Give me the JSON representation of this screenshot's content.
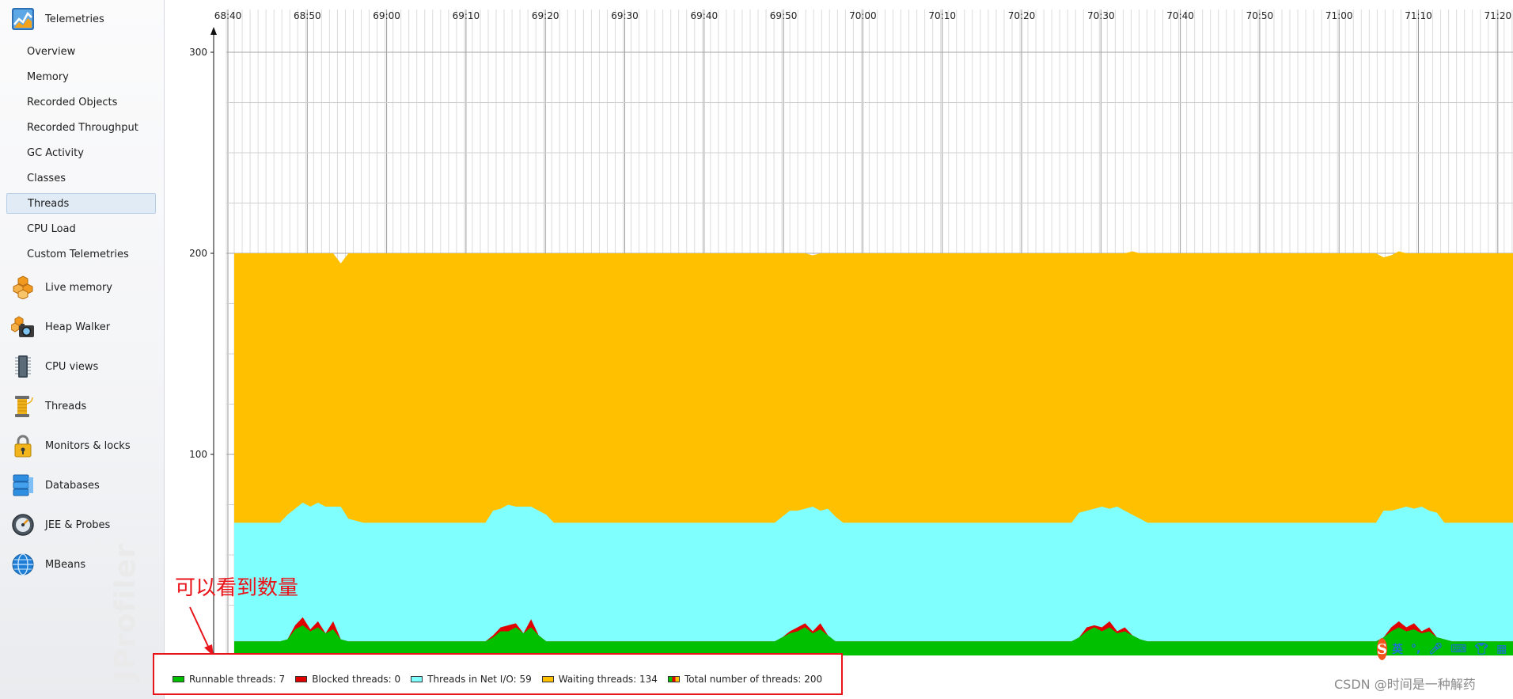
{
  "app": {
    "watermark": "JProfiler"
  },
  "sidebar": {
    "telemetries": {
      "label": "Telemetries",
      "icon": "telemetries-icon",
      "items": [
        {
          "label": "Overview",
          "selected": false
        },
        {
          "label": "Memory",
          "selected": false
        },
        {
          "label": "Recorded Objects",
          "selected": false
        },
        {
          "label": "Recorded Throughput",
          "selected": false
        },
        {
          "label": "GC Activity",
          "selected": false
        },
        {
          "label": "Classes",
          "selected": false
        },
        {
          "label": "Threads",
          "selected": true
        },
        {
          "label": "CPU Load",
          "selected": false
        },
        {
          "label": "Custom Telemetries",
          "selected": false
        }
      ]
    },
    "sections": [
      {
        "label": "Live memory",
        "icon": "live-memory-icon"
      },
      {
        "label": "Heap Walker",
        "icon": "heap-walker-icon"
      },
      {
        "label": "CPU views",
        "icon": "cpu-views-icon"
      },
      {
        "label": "Threads",
        "icon": "threads-icon"
      },
      {
        "label": "Monitors & locks",
        "icon": "monitors-locks-icon"
      },
      {
        "label": "Databases",
        "icon": "databases-icon"
      },
      {
        "label": "JEE & Probes",
        "icon": "jee-probes-icon"
      },
      {
        "label": "MBeans",
        "icon": "mbeans-icon"
      }
    ]
  },
  "chart_data": {
    "type": "area",
    "stacked": true,
    "x_tick_labels": [
      "68:40",
      "68:50",
      "69:00",
      "69:10",
      "69:20",
      "69:30",
      "69:40",
      "69:50",
      "70:00",
      "70:10",
      "70:20",
      "70:30",
      "70:40",
      "70:50",
      "71:00",
      "71:10",
      "71:20"
    ],
    "y_ticks": [
      100,
      200,
      300
    ],
    "ylim": [
      0,
      300
    ],
    "grid": true,
    "series": [
      {
        "name": "Runnable threads",
        "color": "#00c000",
        "values": [
          7,
          7,
          7,
          7,
          7,
          7,
          7,
          8,
          13,
          15,
          12,
          14,
          11,
          13,
          8,
          7,
          7,
          7,
          7,
          7,
          7,
          7,
          7,
          7,
          7,
          7,
          7,
          7,
          7,
          7,
          7,
          7,
          7,
          7,
          9,
          12,
          12,
          14,
          11,
          14,
          10,
          7,
          7,
          7,
          7,
          7,
          7,
          7,
          7,
          7,
          7,
          7,
          7,
          7,
          7,
          7,
          7,
          7,
          7,
          7,
          7,
          7,
          7,
          7,
          7,
          7,
          7,
          7,
          7,
          7,
          7,
          7,
          9,
          11,
          12,
          14,
          11,
          13,
          10,
          7,
          7,
          7,
          7,
          7,
          7,
          7,
          7,
          7,
          7,
          7,
          7,
          7,
          7,
          7,
          7,
          7,
          7,
          7,
          7,
          7,
          7,
          7,
          7,
          7,
          7,
          7,
          7,
          7,
          7,
          7,
          7,
          9,
          12,
          14,
          12,
          14,
          11,
          12,
          10,
          8,
          7,
          7,
          7,
          7,
          7,
          7,
          7,
          7,
          7,
          7,
          7,
          7,
          7,
          7,
          7,
          7,
          7,
          7,
          7,
          7,
          7,
          7,
          7,
          7,
          7,
          7,
          7,
          7,
          7,
          7,
          7,
          9,
          12,
          14,
          12,
          13,
          11,
          12,
          9,
          8,
          7,
          7,
          7,
          7,
          7,
          7,
          7,
          7,
          7
        ]
      },
      {
        "name": "Blocked threads",
        "color": "#e00000",
        "values": [
          0,
          0,
          0,
          0,
          0,
          0,
          0,
          0,
          2,
          4,
          1,
          3,
          0,
          4,
          0,
          0,
          0,
          0,
          0,
          0,
          0,
          0,
          0,
          0,
          0,
          0,
          0,
          0,
          0,
          0,
          0,
          0,
          0,
          0,
          1,
          2,
          3,
          2,
          0,
          4,
          0,
          0,
          0,
          0,
          0,
          0,
          0,
          0,
          0,
          0,
          0,
          0,
          0,
          0,
          0,
          0,
          0,
          0,
          0,
          0,
          0,
          0,
          0,
          0,
          0,
          0,
          0,
          0,
          0,
          0,
          0,
          0,
          0,
          1,
          2,
          2,
          1,
          3,
          0,
          0,
          0,
          0,
          0,
          0,
          0,
          0,
          0,
          0,
          0,
          0,
          0,
          0,
          0,
          0,
          0,
          0,
          0,
          0,
          0,
          0,
          0,
          0,
          0,
          0,
          0,
          0,
          0,
          0,
          0,
          0,
          0,
          0,
          2,
          1,
          2,
          3,
          1,
          2,
          0,
          0,
          0,
          0,
          0,
          0,
          0,
          0,
          0,
          0,
          0,
          0,
          0,
          0,
          0,
          0,
          0,
          0,
          0,
          0,
          0,
          0,
          0,
          0,
          0,
          0,
          0,
          0,
          0,
          0,
          0,
          0,
          0,
          0,
          2,
          3,
          2,
          3,
          1,
          2,
          0,
          0,
          0,
          0,
          0,
          0,
          0,
          0,
          0,
          0,
          0
        ]
      },
      {
        "name": "Threads in Net I/O",
        "color": "#80ffff",
        "values": [
          59,
          59,
          59,
          59,
          59,
          59,
          59,
          62,
          58,
          57,
          61,
          59,
          63,
          57,
          66,
          61,
          60,
          59,
          59,
          59,
          59,
          59,
          59,
          59,
          59,
          59,
          59,
          59,
          59,
          59,
          59,
          59,
          59,
          59,
          62,
          59,
          60,
          58,
          63,
          56,
          62,
          63,
          59,
          59,
          59,
          59,
          59,
          59,
          59,
          59,
          59,
          59,
          59,
          59,
          59,
          59,
          59,
          59,
          59,
          59,
          59,
          59,
          59,
          59,
          59,
          59,
          59,
          59,
          59,
          59,
          59,
          59,
          60,
          60,
          58,
          57,
          62,
          56,
          63,
          62,
          59,
          59,
          59,
          59,
          59,
          59,
          59,
          59,
          59,
          59,
          59,
          59,
          59,
          59,
          59,
          59,
          59,
          59,
          59,
          59,
          59,
          59,
          59,
          59,
          59,
          59,
          59,
          59,
          59,
          59,
          59,
          62,
          58,
          58,
          60,
          56,
          62,
          58,
          60,
          60,
          59,
          59,
          59,
          59,
          59,
          59,
          59,
          59,
          59,
          59,
          59,
          59,
          59,
          59,
          59,
          59,
          59,
          59,
          59,
          59,
          59,
          59,
          59,
          59,
          59,
          59,
          59,
          59,
          59,
          59,
          59,
          63,
          58,
          56,
          60,
          57,
          62,
          58,
          62,
          58,
          59,
          59,
          59,
          59,
          59,
          59,
          59,
          59,
          59
        ]
      },
      {
        "name": "Waiting threads",
        "color": "#ffc000",
        "values": [
          134,
          134,
          134,
          134,
          134,
          134,
          134,
          130,
          127,
          124,
          126,
          124,
          126,
          126,
          121,
          132,
          133,
          134,
          134,
          134,
          134,
          134,
          134,
          134,
          134,
          134,
          134,
          134,
          134,
          134,
          134,
          134,
          134,
          134,
          128,
          127,
          125,
          126,
          126,
          126,
          128,
          130,
          134,
          134,
          134,
          134,
          134,
          134,
          134,
          134,
          134,
          134,
          134,
          134,
          134,
          134,
          134,
          134,
          134,
          134,
          134,
          134,
          134,
          134,
          134,
          134,
          134,
          134,
          134,
          134,
          134,
          134,
          131,
          128,
          128,
          127,
          125,
          128,
          127,
          131,
          134,
          134,
          134,
          134,
          134,
          134,
          134,
          134,
          134,
          134,
          134,
          134,
          134,
          134,
          134,
          134,
          134,
          134,
          134,
          134,
          134,
          134,
          134,
          134,
          134,
          134,
          134,
          134,
          134,
          134,
          134,
          129,
          128,
          127,
          126,
          127,
          126,
          128,
          131,
          132,
          134,
          134,
          134,
          134,
          134,
          134,
          134,
          134,
          134,
          134,
          134,
          134,
          134,
          134,
          134,
          134,
          134,
          134,
          134,
          134,
          134,
          134,
          134,
          134,
          134,
          134,
          134,
          134,
          134,
          134,
          134,
          126,
          127,
          128,
          126,
          127,
          126,
          128,
          129,
          134,
          134,
          134,
          134,
          134,
          134,
          134,
          134,
          134,
          134
        ]
      }
    ]
  },
  "legend": [
    {
      "label": "Runnable threads: 7",
      "color": "#00c000"
    },
    {
      "label": "Blocked threads: 0",
      "color": "#e00000"
    },
    {
      "label": "Threads in Net I/O: 59",
      "color": "#80ffff"
    },
    {
      "label": "Waiting threads: 134",
      "color": "#ffc000"
    },
    {
      "label": "Total number of threads: 200",
      "color": "multi"
    }
  ],
  "annotation": {
    "text": "可以看到数量",
    "color": "#e8141a"
  },
  "ime": {
    "label": "英"
  },
  "footer_watermark": "CSDN @时间是一种解药"
}
